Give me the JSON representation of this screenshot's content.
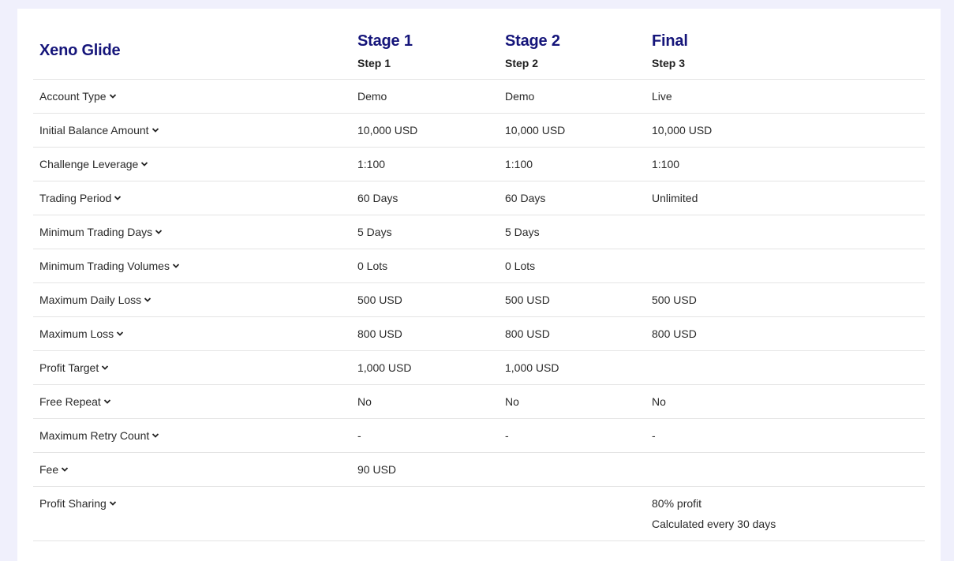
{
  "brand": "Xeno Glide",
  "stages": [
    {
      "title": "Stage 1",
      "step": "Step 1"
    },
    {
      "title": "Stage 2",
      "step": "Step 2"
    },
    {
      "title": "Final",
      "step": "Step 3"
    }
  ],
  "rows": [
    {
      "label": "Account Type",
      "values": [
        "Demo",
        "Demo",
        "Live"
      ]
    },
    {
      "label": "Initial Balance Amount",
      "values": [
        "10,000 USD",
        "10,000 USD",
        "10,000 USD"
      ]
    },
    {
      "label": "Challenge Leverage",
      "values": [
        "1:100",
        "1:100",
        "1:100"
      ]
    },
    {
      "label": "Trading Period",
      "values": [
        "60 Days",
        "60 Days",
        "Unlimited"
      ]
    },
    {
      "label": "Minimum Trading Days",
      "values": [
        "5 Days",
        "5 Days",
        ""
      ]
    },
    {
      "label": "Minimum Trading Volumes",
      "values": [
        "0 Lots",
        "0 Lots",
        ""
      ]
    },
    {
      "label": "Maximum Daily Loss",
      "values": [
        "500 USD",
        "500 USD",
        "500 USD"
      ]
    },
    {
      "label": "Maximum Loss",
      "values": [
        "800 USD",
        "800 USD",
        "800 USD"
      ]
    },
    {
      "label": "Profit Target",
      "values": [
        "1,000 USD",
        "1,000 USD",
        ""
      ]
    },
    {
      "label": "Free Repeat",
      "values": [
        "No",
        "No",
        "No"
      ]
    },
    {
      "label": "Maximum Retry Count",
      "values": [
        "-",
        "-",
        "-"
      ]
    },
    {
      "label": "Fee",
      "values": [
        "90 USD",
        "",
        ""
      ]
    },
    {
      "label": "Profit Sharing",
      "values": [
        "",
        "",
        ""
      ],
      "final_lines": [
        "80% profit",
        "Calculated every 30 days"
      ]
    }
  ],
  "icons": {
    "row_toggle": "chevron-down-icon"
  },
  "colors": {
    "brand": "#15157a",
    "page_bg": "#f0f0fc",
    "card_bg": "#ffffff",
    "divider": "#e4e4e4"
  }
}
